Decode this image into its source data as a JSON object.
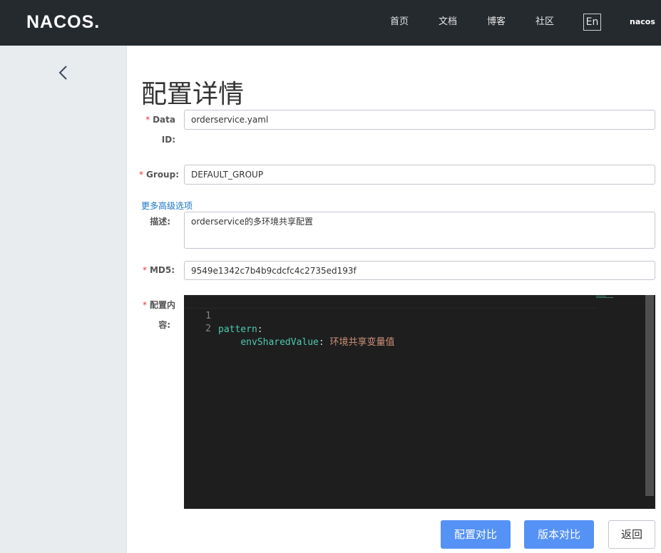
{
  "header": {
    "logo": "NACOS.",
    "nav": [
      "首页",
      "文档",
      "博客",
      "社区"
    ],
    "lang_button": "En",
    "user": "nacos"
  },
  "sidebar": {
    "back_icon": "chevron-left-icon"
  },
  "page": {
    "title": "配置详情"
  },
  "form": {
    "data_id": {
      "label_line1": "Data",
      "label_line2": "ID:",
      "value": "orderservice.yaml",
      "required": true
    },
    "group": {
      "label": "Group:",
      "value": "DEFAULT_GROUP",
      "required": true
    },
    "advanced_link": "更多高级选项",
    "description": {
      "label": "描述:",
      "value": "orderservice的多环境共享配置"
    },
    "md5": {
      "label": "MD5:",
      "value": "9549e1342c7b4b9cdcfc4c2735ed193f",
      "required": true
    },
    "content": {
      "label_line1": "配置内",
      "label_line2": "容:",
      "required": true
    },
    "required_mark": "*"
  },
  "editor": {
    "lines": [
      {
        "num": "1",
        "indent": "",
        "key": "pattern",
        "sep": ":",
        "value": ""
      },
      {
        "num": "2",
        "indent": "    ",
        "key": "envSharedValue",
        "sep": ": ",
        "value": "环境共享变量值"
      }
    ]
  },
  "buttons": {
    "compare_config": "配置对比",
    "compare_version": "版本对比",
    "back": "返回"
  },
  "colors": {
    "header_bg": "#252a2f",
    "sidebar_bg": "#e8ecef",
    "primary": "#5592f5",
    "required": "#e4393c",
    "link": "#1a73c8",
    "editor_bg": "#1e1e1e"
  }
}
